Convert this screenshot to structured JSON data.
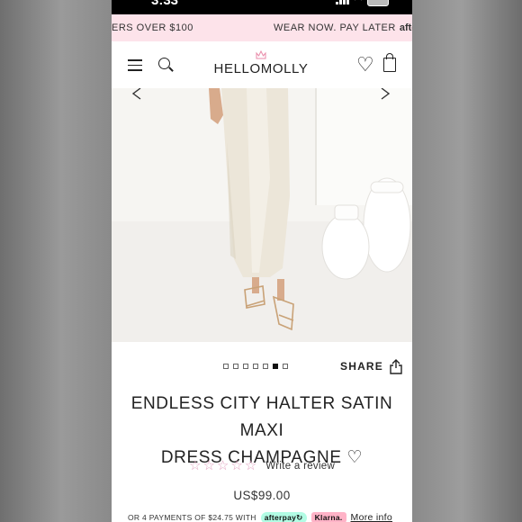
{
  "status_bar": {
    "time": "3:33"
  },
  "promo_banner": {
    "left_text": "ERS OVER $100",
    "right_text": "WEAR NOW. PAY LATER",
    "right_brand": "afterpa"
  },
  "header": {
    "logo_text": "HELLOMOLLY",
    "icons": [
      "menu-icon",
      "search-icon",
      "crown-icon",
      "heart-icon",
      "bag-icon"
    ]
  },
  "gallery": {
    "image_count": 7,
    "active_index": 5,
    "share_label": "SHARE"
  },
  "product": {
    "title_line1": "ENDLESS CITY HALTER SATIN MAXI",
    "title_line2": "DRESS CHAMPAGNE ♡",
    "rating_stars": 0,
    "review_link": "Write a review",
    "price": "US$99.00"
  },
  "payments": {
    "text": "OR 4 PAYMENTS OF $24.75 WITH",
    "afterpay_label": "afterpay↻",
    "klarna_label": "Klarna.",
    "more_info": "More info"
  },
  "colors": {
    "promo_bg": "#fde3ea",
    "star": "#e2a0bf",
    "afterpay_badge": "#b2fce4",
    "klarna_badge": "#ffb3c7"
  }
}
